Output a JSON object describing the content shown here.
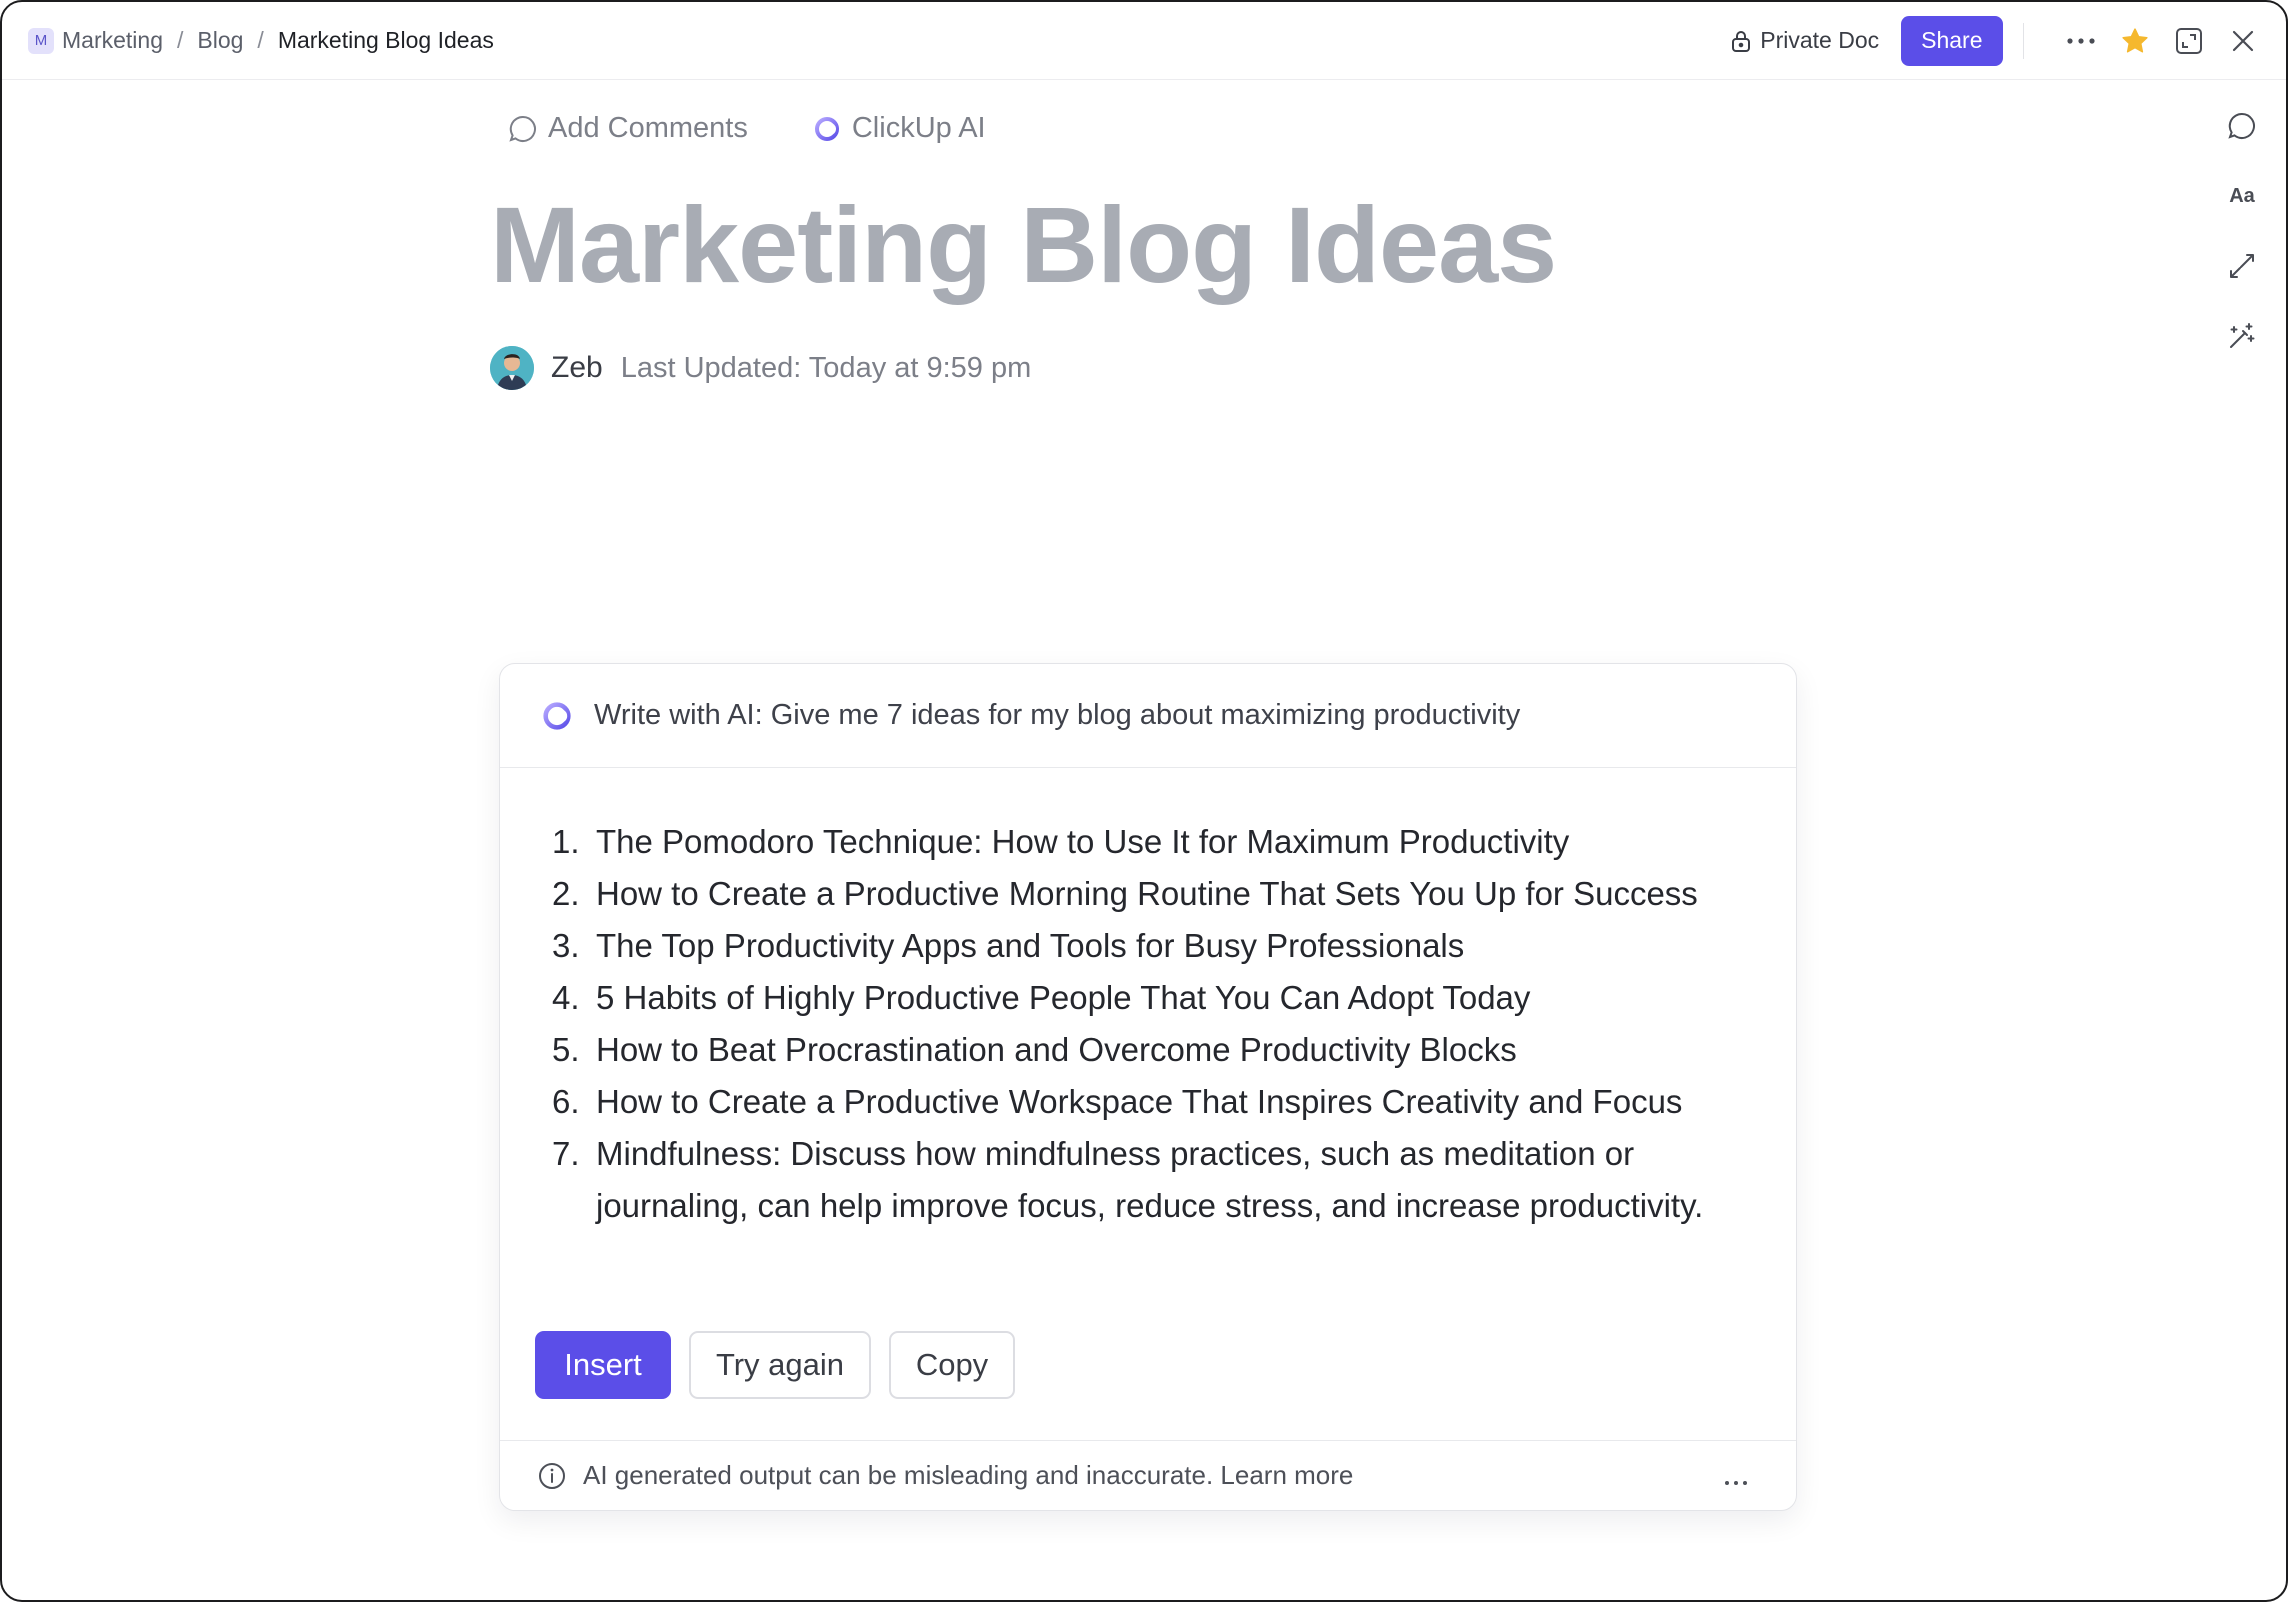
{
  "breadcrumb": {
    "space_initial": "M",
    "items": [
      "Marketing",
      "Blog",
      "Marketing Blog Ideas"
    ],
    "separator": "/"
  },
  "topbar": {
    "private_label": "Private Doc",
    "share_label": "Share",
    "icons": [
      "lock-icon",
      "more-horizontal-icon",
      "star-icon",
      "expand-icon",
      "close-icon"
    ],
    "star_color": "#F5B82E"
  },
  "rail": {
    "icons": [
      "comment-icon",
      "text-format-icon",
      "sync-icon",
      "magic-wand-icon"
    ],
    "text_format_label": "Aa"
  },
  "doc": {
    "actions": {
      "add_comments": "Add Comments",
      "clickup_ai": "ClickUp AI"
    },
    "title": "Marketing Blog Ideas",
    "author": "Zeb",
    "last_updated": "Last Updated: Today at 9:59 pm"
  },
  "ai_panel": {
    "prompt": "Write with AI: Give me 7 ideas for my blog about maximizing productivity",
    "ideas": [
      {
        "num": "1.",
        "text": "The Pomodoro Technique: How to Use It for Maximum Productivity"
      },
      {
        "num": "2.",
        "text": "How to Create a Productive Morning Routine That Sets You Up for Success"
      },
      {
        "num": "3.",
        "text": "The Top Productivity Apps and Tools for Busy Professionals"
      },
      {
        "num": "4.",
        "text": "5 Habits of Highly Productive People That You Can Adopt Today"
      },
      {
        "num": "5.",
        "text": "How to Beat Procrastination and Overcome Productivity Blocks"
      },
      {
        "num": "6.",
        "text": "How to Create a Productive Workspace That Inspires Creativity and Focus"
      },
      {
        "num": "7.",
        "text": "Mindfulness: Discuss how mindfulness practices, such as meditation or journaling, can help improve focus, reduce stress, and increase productivity."
      }
    ],
    "buttons": {
      "insert": "Insert",
      "try_again": "Try again",
      "copy": "Copy"
    },
    "disclaimer": "AI generated output can be misleading and inaccurate. Learn more"
  },
  "colors": {
    "accent": "#5B4EE8",
    "title_gray": "#A8ACB4"
  }
}
